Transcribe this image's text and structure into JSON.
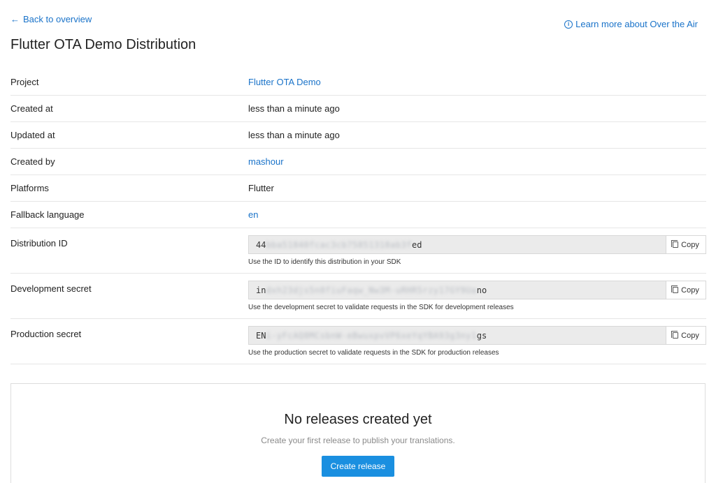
{
  "nav": {
    "back_label": "Back to overview",
    "learn_more_label": "Learn more about Over the Air"
  },
  "page_title": "Flutter OTA Demo Distribution",
  "details": {
    "project": {
      "label": "Project",
      "value": "Flutter OTA Demo"
    },
    "created_at": {
      "label": "Created at",
      "value": "less than a minute ago"
    },
    "updated_at": {
      "label": "Updated at",
      "value": "less than a minute ago"
    },
    "created_by": {
      "label": "Created by",
      "value": "mashour"
    },
    "platforms": {
      "label": "Platforms",
      "value": "Flutter"
    },
    "fallback_language": {
      "label": "Fallback language",
      "value": "en"
    }
  },
  "secrets": {
    "distribution_id": {
      "label": "Distribution ID",
      "value_start": "44",
      "value_blurred": "bba51840fcac3cb75851318ab3f",
      "value_end": "ed",
      "copy_label": "Copy",
      "hint": "Use the ID to identify this distribution in your SDK"
    },
    "development_secret": {
      "label": "Development secret",
      "value_start": "in",
      "value_blurred": "dxh23djs5n0fiuFaqw_Nw3M-uRHR5rzy17GY9Ua",
      "value_end": "no",
      "copy_label": "Copy",
      "hint": "Use the development secret to validate requests in the SDK for development releases"
    },
    "production_secret": {
      "label": "Production secret",
      "value_start": "EN",
      "value_blurred": "i-yFcAQ8MCsbnW-eBwuxpvVP6xeYqYBA93g3ny1",
      "value_end": "gs",
      "copy_label": "Copy",
      "hint": "Use the production secret to validate requests in the SDK for production releases"
    }
  },
  "empty_state": {
    "title": "No releases created yet",
    "subtitle": "Create your first release to publish your translations.",
    "button_label": "Create release"
  },
  "colors": {
    "link": "#1a73c9",
    "primary_button": "#1a8fe0"
  }
}
